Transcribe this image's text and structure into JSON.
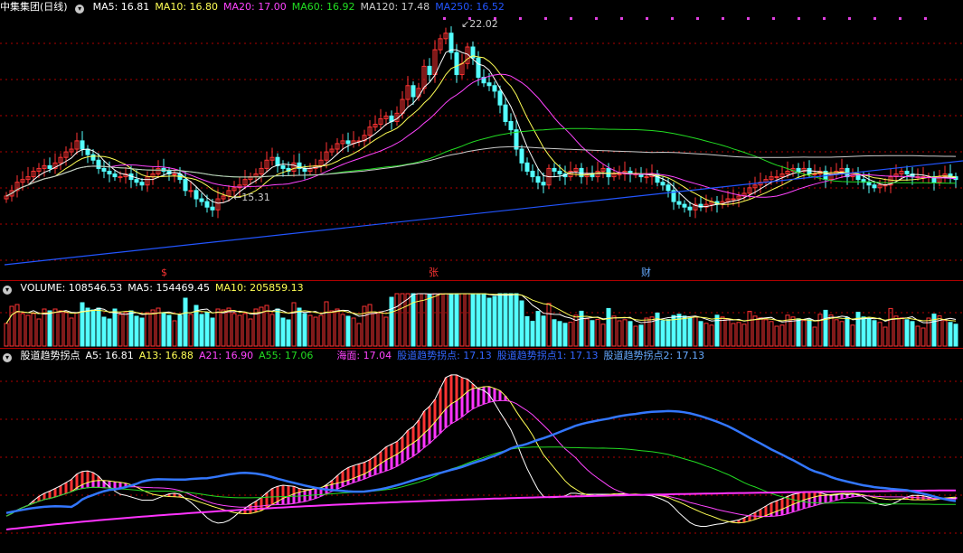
{
  "price_panel": {
    "title": "中集集团(日线)",
    "ma_labels": [
      {
        "text": "MA5: 16.81",
        "color": "#ffffff"
      },
      {
        "text": "MA10: 16.80",
        "color": "#ffff55"
      },
      {
        "text": "MA20: 17.00",
        "color": "#ff44ff"
      },
      {
        "text": "MA60: 16.92",
        "color": "#22dd22"
      },
      {
        "text": "MA120: 17.48",
        "color": "#cccccc"
      },
      {
        "text": "MA250: 16.52",
        "color": "#2255ff"
      }
    ],
    "high_label": "22.02",
    "low_label": "15.31",
    "markers": [
      {
        "text": "$",
        "color": "#ff3333"
      },
      {
        "text": "张",
        "color": "#ff3333"
      },
      {
        "text": "财",
        "color": "#66aaff"
      }
    ]
  },
  "volume_panel": {
    "labels": [
      {
        "text": "VOLUME: 108546.53",
        "color": "#ffffff"
      },
      {
        "text": "MA5: 154469.45",
        "color": "#ffffff"
      },
      {
        "text": "MA10: 205859.13",
        "color": "#ffff55"
      }
    ]
  },
  "indicator_panel": {
    "labels": [
      {
        "text": "股道趋势拐点",
        "color": "#ffffff"
      },
      {
        "text": "A5: 16.81",
        "color": "#ffffff"
      },
      {
        "text": "A13: 16.88",
        "color": "#ffff55"
      },
      {
        "text": "A21: 16.90",
        "color": "#ff44ff"
      },
      {
        "text": "A55: 17.06",
        "color": "#22dd22"
      },
      {
        "text": "海面: 17.04",
        "color": "#ff44ff"
      },
      {
        "text": "股道趋势拐点: 17.13",
        "color": "#3366ff"
      },
      {
        "text": "股道趋势拐点1: 17.13",
        "color": "#3366ff"
      },
      {
        "text": "股道趋势拐点2: 17.13",
        "color": "#66aaff"
      }
    ]
  },
  "colors": {
    "up": "#ff3333",
    "down": "#54ffff",
    "grid": "#b00000"
  },
  "chart_data": {
    "type": "line",
    "x_count": 176,
    "price_close": [
      15.9,
      16.1,
      16.4,
      16.5,
      16.6,
      16.8,
      16.9,
      17.0,
      16.9,
      17.1,
      17.3,
      17.5,
      17.6,
      17.9,
      17.6,
      17.4,
      17.2,
      16.9,
      16.8,
      16.7,
      16.6,
      16.6,
      16.7,
      16.5,
      16.4,
      16.3,
      16.6,
      16.7,
      16.9,
      16.8,
      16.7,
      16.7,
      16.5,
      16.1,
      16.1,
      15.8,
      15.7,
      15.5,
      15.4,
      15.8,
      15.9,
      16.1,
      16.2,
      16.3,
      16.5,
      16.6,
      16.7,
      16.9,
      17.2,
      17.3,
      17.0,
      16.9,
      16.8,
      17.1,
      16.9,
      16.8,
      16.9,
      17.0,
      17.2,
      17.5,
      17.6,
      17.8,
      17.9,
      17.8,
      17.9,
      17.9,
      18.1,
      18.4,
      18.5,
      18.7,
      18.8,
      18.6,
      18.9,
      19.4,
      19.9,
      19.5,
      19.8,
      20.6,
      20.3,
      21.2,
      21.6,
      21.8,
      21.1,
      20.3,
      20.7,
      21.3,
      20.9,
      20.2,
      20.0,
      19.9,
      19.7,
      19.2,
      18.6,
      18.3,
      17.6,
      17.1,
      16.8,
      16.6,
      16.4,
      16.3,
      16.9,
      16.8,
      16.7,
      16.6,
      16.8,
      16.9,
      16.6,
      16.7,
      16.6,
      16.8,
      16.9,
      16.6,
      16.7,
      16.7,
      16.8,
      16.7,
      16.7,
      16.6,
      16.6,
      16.7,
      16.4,
      16.3,
      16.1,
      15.7,
      15.6,
      15.5,
      15.4,
      15.6,
      15.5,
      15.6,
      15.7,
      15.6,
      15.7,
      15.8,
      15.8,
      15.9,
      16.0,
      16.2,
      16.3,
      16.4,
      16.5,
      16.6,
      16.6,
      16.7,
      16.8,
      16.9,
      16.8,
      16.9,
      16.7,
      16.7,
      16.8,
      16.5,
      16.7,
      16.8,
      16.9,
      16.6,
      16.7,
      16.5,
      16.4,
      16.3,
      16.2,
      16.3,
      16.3,
      16.6,
      16.7,
      16.8,
      16.7,
      16.6,
      16.6,
      16.6,
      16.6,
      16.4,
      16.6,
      16.7,
      16.6,
      16.5
    ],
    "high": 22.02,
    "low": 15.31,
    "volume_scale": "relative"
  }
}
